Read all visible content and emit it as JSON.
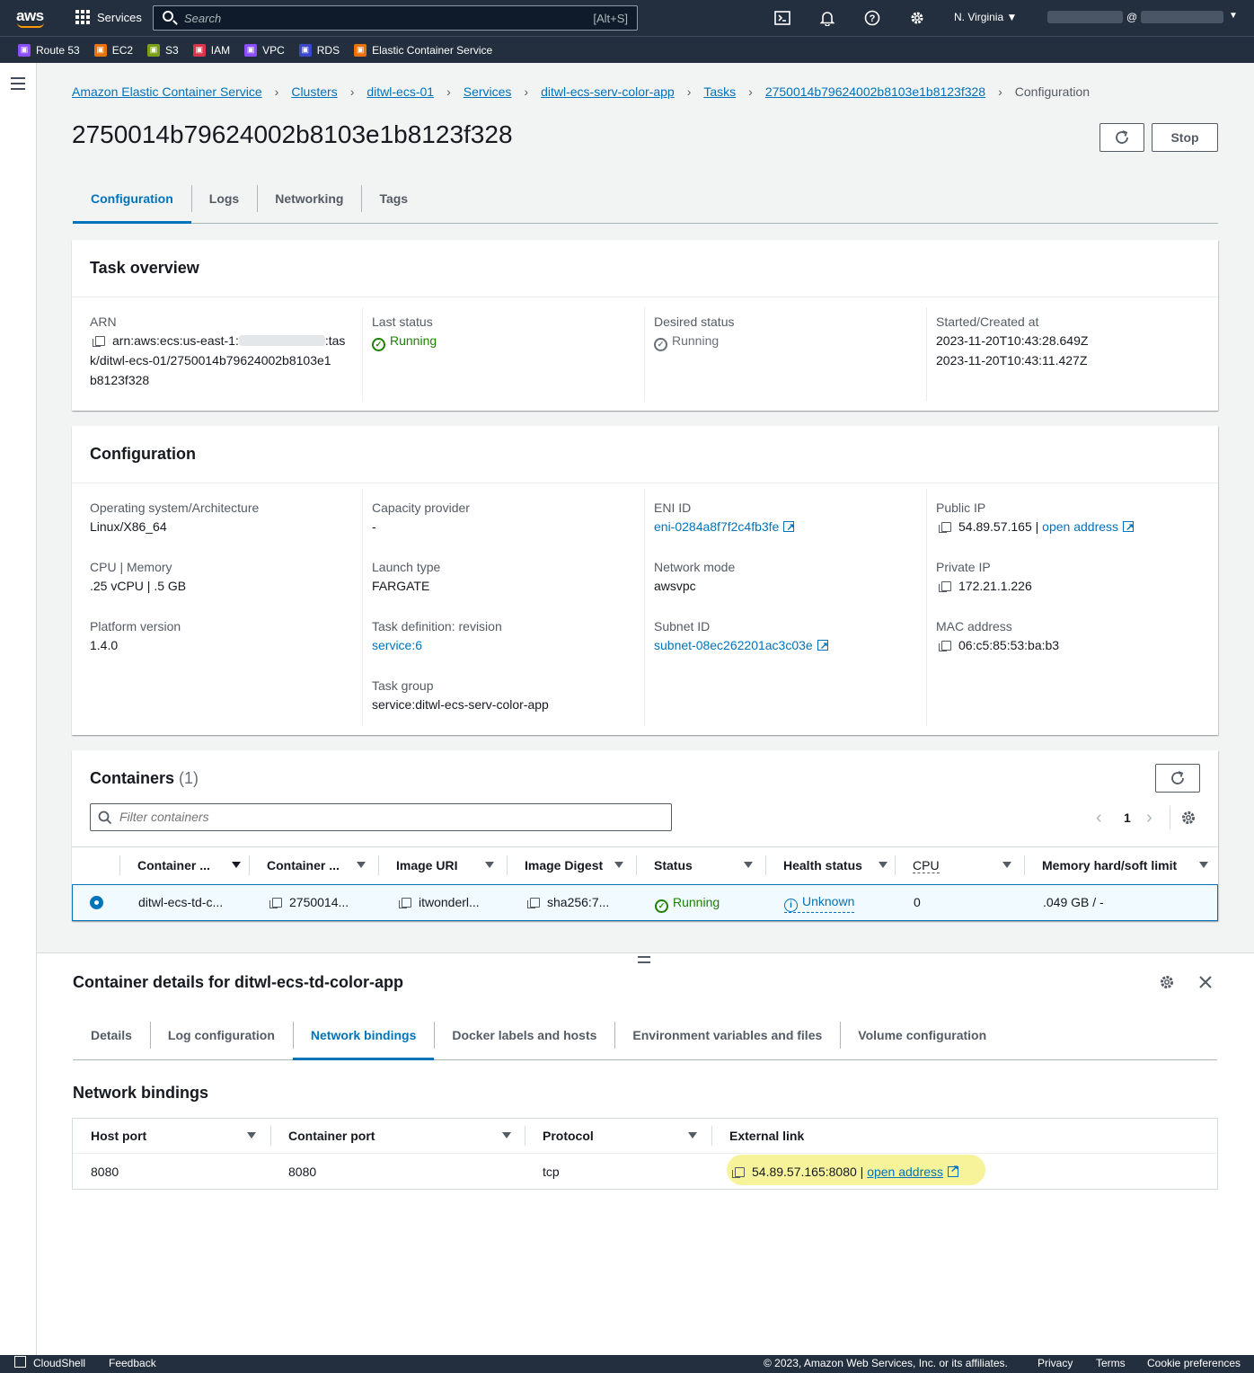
{
  "topnav": {
    "logo": "aws",
    "services_label": "Services",
    "search_placeholder": "Search",
    "search_hint": "[Alt+S]",
    "region": "N. Virginia",
    "account_at": "@"
  },
  "favorites": [
    {
      "label": "Route 53",
      "color": "#8c4fff",
      "icon": "route53-icon"
    },
    {
      "label": "EC2",
      "color": "#ed7100",
      "icon": "ec2-icon"
    },
    {
      "label": "S3",
      "color": "#7aa116",
      "icon": "s3-icon"
    },
    {
      "label": "IAM",
      "color": "#dd344c",
      "icon": "iam-icon"
    },
    {
      "label": "VPC",
      "color": "#8c4fff",
      "icon": "vpc-icon"
    },
    {
      "label": "RDS",
      "color": "#3b48cc",
      "icon": "rds-icon"
    },
    {
      "label": "Elastic Container Service",
      "color": "#ed7100",
      "icon": "ecs-icon"
    }
  ],
  "breadcrumb": [
    "Amazon Elastic Container Service",
    "Clusters",
    "ditwl-ecs-01",
    "Services",
    "ditwl-ecs-serv-color-app",
    "Tasks",
    "2750014b79624002b8103e1b8123f328"
  ],
  "breadcrumb_current": "Configuration",
  "page_title": "2750014b79624002b8103e1b8123f328",
  "stop_label": "Stop",
  "tabs": [
    "Configuration",
    "Logs",
    "Networking",
    "Tags"
  ],
  "task_overview": {
    "title": "Task overview",
    "arn_label": "ARN",
    "arn_line1_a": "arn:aws:ecs:us-east-1:",
    "arn_line1_b": ":tas",
    "arn_line2": "k/ditwl-ecs-01/2750014b79624002b8103e1",
    "arn_line3": "b8123f328",
    "last_status_label": "Last status",
    "last_status": "Running",
    "desired_status_label": "Desired status",
    "desired_status": "Running",
    "started_label": "Started/Created at",
    "started": "2023-11-20T10:43:28.649Z",
    "created": "2023-11-20T10:43:11.427Z"
  },
  "configuration": {
    "title": "Configuration",
    "os_label": "Operating system/Architecture",
    "os": "Linux/X86_64",
    "cpu_label": "CPU | Memory",
    "cpu": ".25 vCPU | .5 GB",
    "platform_label": "Platform version",
    "platform": "1.4.0",
    "capacity_label": "Capacity provider",
    "capacity": "-",
    "launch_label": "Launch type",
    "launch": "FARGATE",
    "taskdef_label": "Task definition: revision",
    "taskdef": "service:6",
    "taskgroup_label": "Task group",
    "taskgroup": "service:ditwl-ecs-serv-color-app",
    "eni_label": "ENI ID",
    "eni": "eni-0284a8f7f2c4fb3fe",
    "netmode_label": "Network mode",
    "netmode": "awsvpc",
    "subnet_label": "Subnet ID",
    "subnet": "subnet-08ec262201ac3c03e",
    "public_ip_label": "Public IP",
    "public_ip": "54.89.57.165",
    "open_address": "open address",
    "private_ip_label": "Private IP",
    "private_ip": "172.21.1.226",
    "mac_label": "MAC address",
    "mac": "06:c5:85:53:ba:b3"
  },
  "containers": {
    "title": "Containers",
    "count": "(1)",
    "filter_placeholder": "Filter containers",
    "page": "1",
    "columns": [
      "Container ...",
      "Container ...",
      "Image URI",
      "Image Digest",
      "Status",
      "Health status",
      "CPU",
      "Memory hard/soft limit"
    ],
    "row": {
      "name": "ditwl-ecs-td-c...",
      "id": "2750014...",
      "image": "itwonderl...",
      "digest": "sha256:7...",
      "status": "Running",
      "health": "Unknown",
      "cpu": "0",
      "memory": ".049 GB / -"
    }
  },
  "details": {
    "title": "Container details for ditwl-ecs-td-color-app",
    "tabs": [
      "Details",
      "Log configuration",
      "Network bindings",
      "Docker labels and hosts",
      "Environment variables and files",
      "Volume configuration"
    ],
    "section_title": "Network bindings",
    "columns": [
      "Host port",
      "Container port",
      "Protocol",
      "External link"
    ],
    "row": {
      "host_port": "8080",
      "container_port": "8080",
      "protocol": "tcp",
      "external": "54.89.57.165:8080",
      "sep": "|",
      "open_address": "open address"
    }
  },
  "footer": {
    "cloudshell": "CloudShell",
    "feedback": "Feedback",
    "copyright": "© 2023, Amazon Web Services, Inc. or its affiliates.",
    "privacy": "Privacy",
    "terms": "Terms",
    "cookies": "Cookie preferences"
  }
}
